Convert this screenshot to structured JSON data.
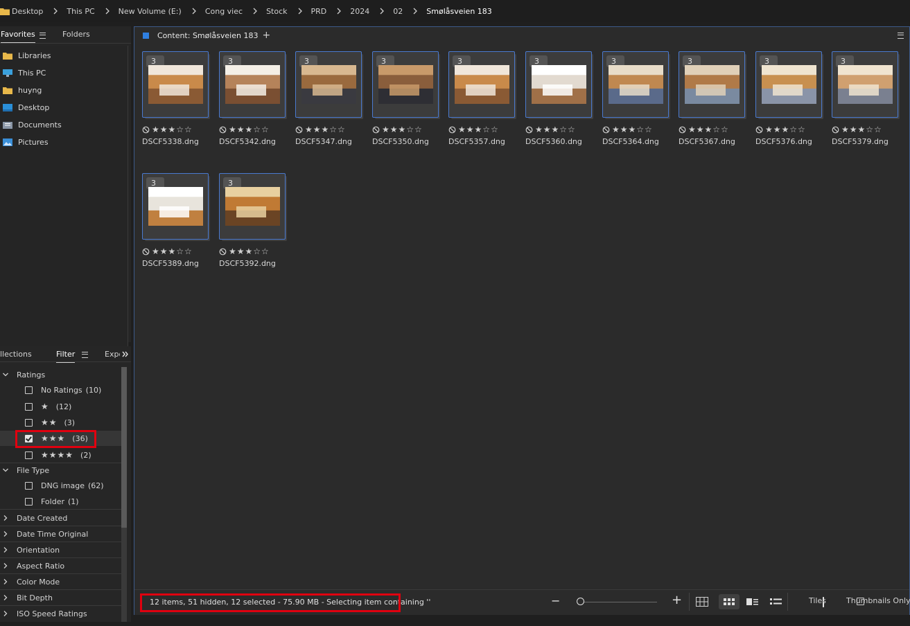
{
  "breadcrumb": [
    "Desktop",
    "This PC",
    "New Volume (E:)",
    "Cong viec",
    "Stock",
    "PRD",
    "2024",
    "02",
    "Smølåsveien 183"
  ],
  "left_panel": {
    "tabs": {
      "favorites": "Favorites",
      "folders": "Folders"
    },
    "favorites": [
      {
        "label": "Libraries",
        "icon": "folder-icon"
      },
      {
        "label": "This PC",
        "icon": "computer-icon"
      },
      {
        "label": "huyng",
        "icon": "folder-icon"
      },
      {
        "label": "Desktop",
        "icon": "desktop-icon"
      },
      {
        "label": "Documents",
        "icon": "documents-icon"
      },
      {
        "label": "Pictures",
        "icon": "pictures-icon"
      }
    ]
  },
  "filter_panel": {
    "tabs": {
      "collections": "llections",
      "filter": "Filter",
      "export": "Expo"
    },
    "ratings": {
      "title": "Ratings",
      "items": [
        {
          "label": "No Ratings",
          "count": "(10)",
          "checked": false
        },
        {
          "stars": "★",
          "count": "(12)",
          "checked": false
        },
        {
          "stars": "★★",
          "count": "(3)",
          "checked": false
        },
        {
          "stars": "★★★",
          "count": "(36)",
          "checked": true
        },
        {
          "stars": "★★★★",
          "count": "(2)",
          "checked": false
        }
      ]
    },
    "file_type": {
      "title": "File Type",
      "items": [
        {
          "label": "DNG image",
          "count": "(62)",
          "checked": false
        },
        {
          "label": "Folder",
          "count": "(1)",
          "checked": false
        }
      ]
    },
    "collapsed_sections": [
      "Date Created",
      "Date Time Original",
      "Orientation",
      "Aspect Ratio",
      "Color Mode",
      "Bit Depth",
      "ISO Speed Ratings"
    ]
  },
  "content": {
    "title": "Content: Smølåsveien 183",
    "add_label": "+",
    "stack_count": "3",
    "tiles": [
      {
        "name": "DSCF5338.dng",
        "rating": "★★★☆☆"
      },
      {
        "name": "DSCF5342.dng",
        "rating": "★★★☆☆"
      },
      {
        "name": "DSCF5347.dng",
        "rating": "★★★☆☆"
      },
      {
        "name": "DSCF5350.dng",
        "rating": "★★★☆☆"
      },
      {
        "name": "DSCF5357.dng",
        "rating": "★★★☆☆"
      },
      {
        "name": "DSCF5360.dng",
        "rating": "★★★☆☆"
      },
      {
        "name": "DSCF5364.dng",
        "rating": "★★★☆☆"
      },
      {
        "name": "DSCF5367.dng",
        "rating": "★★★☆☆"
      },
      {
        "name": "DSCF5376.dng",
        "rating": "★★★☆☆"
      },
      {
        "name": "DSCF5379.dng",
        "rating": "★★★☆☆"
      },
      {
        "name": "DSCF5389.dng",
        "rating": "★★★☆☆"
      },
      {
        "name": "DSCF5392.dng",
        "rating": "★★★☆☆"
      }
    ],
    "status_text": "12 items, 51 hidden, 12 selected - 75.90 MB - Selecting item containing ''",
    "zoom_minus": "−",
    "zoom_plus": "+",
    "zoom_level": 0.0,
    "tiles_label": "Tiles",
    "tiles_checked": true,
    "thumbnails_only_label": "Thumbnails Only",
    "thumbnails_only_checked": false
  },
  "colors": {
    "selection_blue": "#4a7ad0",
    "highlight_red": "#e0000f",
    "panel_bg": "#2b2b2b"
  }
}
